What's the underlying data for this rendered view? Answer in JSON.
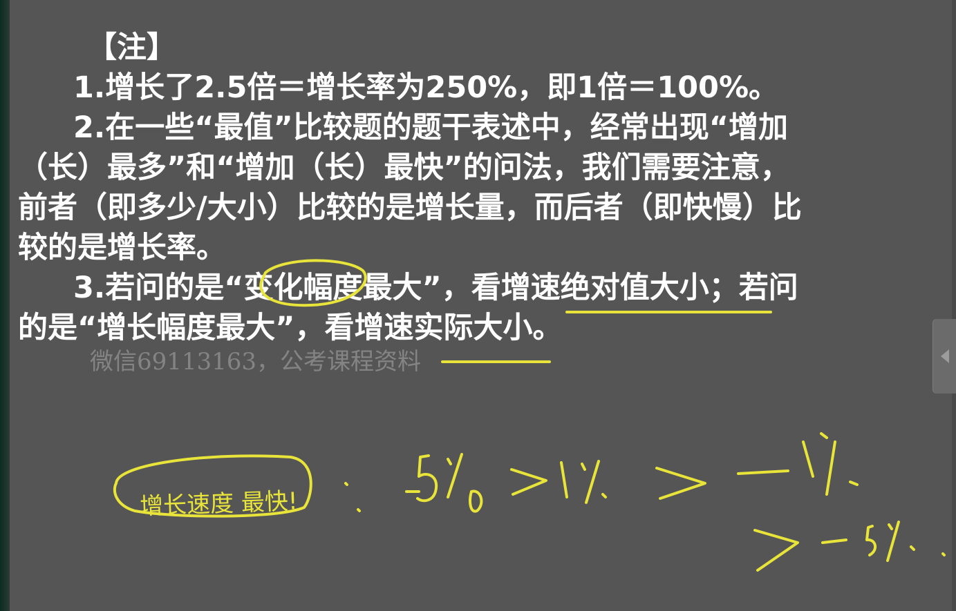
{
  "slide": {
    "note_heading": "【注】",
    "line_1": "1.增长了2.5倍＝增长率为250%，即1倍＝100%。",
    "line_2": "2.在一些“最值”比较题的题干表述中，经常出现“增加",
    "line_3": "（长）最多”和“增加（长）最快”的问法，我们需要注意，",
    "line_4": "前者（即多少/大小）比较的是增长量，而后者（即快慢）比",
    "line_5": "较的是增长率。",
    "line_6": "3.若问的是“变化幅度最大”，看增速绝对值大小；若问",
    "line_7": "的是“增长幅度最大”，看增速实际大小。"
  },
  "watermark": "微信69113163，公考课程资料",
  "annotations": {
    "circled_label": "增长速度 最快!",
    "ink_color": "#e8e43a"
  },
  "colors": {
    "background": "#555555",
    "text": "#ffffff"
  }
}
